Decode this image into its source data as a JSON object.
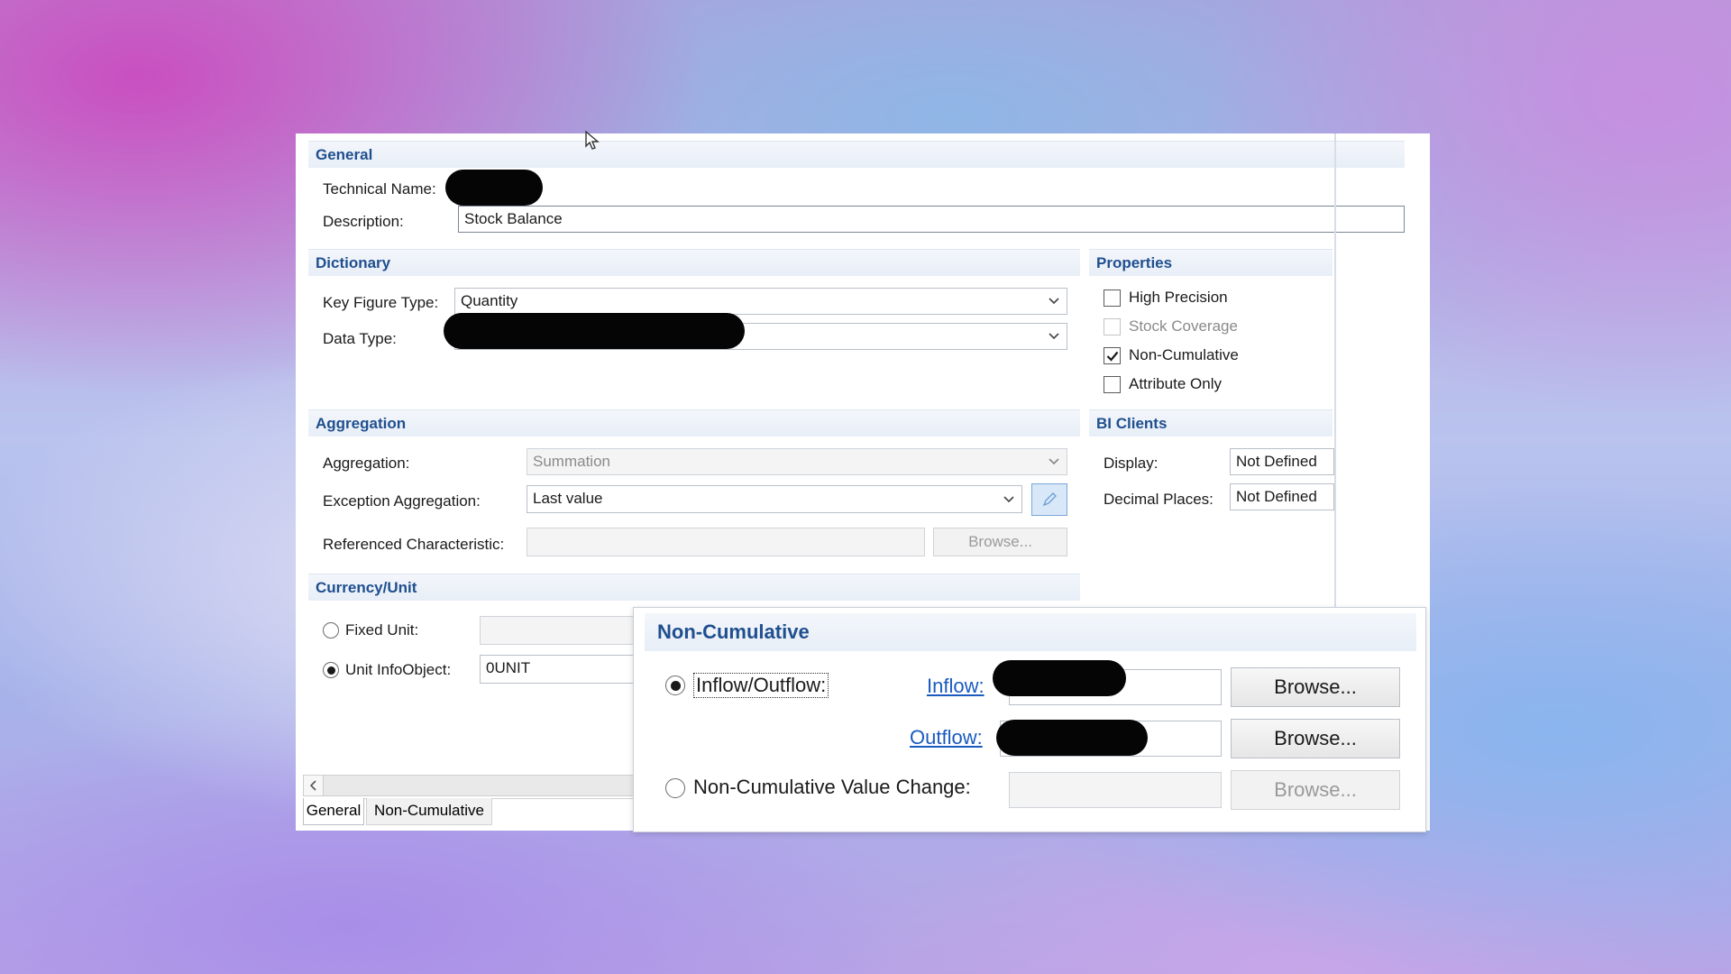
{
  "general": {
    "section_title": "General",
    "technical_name_label": "Technical Name:",
    "description_label": "Description:",
    "description_value": "Stock Balance"
  },
  "dictionary": {
    "section_title": "Dictionary",
    "key_figure_type_label": "Key Figure Type:",
    "key_figure_type_value": "Quantity",
    "data_type_label": "Data Type:"
  },
  "properties": {
    "section_title": "Properties",
    "items": [
      {
        "label": "High Precision",
        "checked": false,
        "enabled": true
      },
      {
        "label": "Stock Coverage",
        "checked": false,
        "enabled": false
      },
      {
        "label": "Non-Cumulative",
        "checked": true,
        "enabled": true
      },
      {
        "label": "Attribute Only",
        "checked": false,
        "enabled": true
      }
    ]
  },
  "aggregation": {
    "section_title": "Aggregation",
    "aggregation_label": "Aggregation:",
    "aggregation_value": "Summation",
    "exception_label": "Exception Aggregation:",
    "exception_value": "Last value",
    "referenced_label": "Referenced Characteristic:",
    "browse_label": "Browse..."
  },
  "bi_clients": {
    "section_title": "BI Clients",
    "display_label": "Display:",
    "display_value": "Not Defined",
    "decimal_label": "Decimal Places:",
    "decimal_value": "Not Defined"
  },
  "currency_unit": {
    "section_title": "Currency/Unit",
    "fixed_unit_label": "Fixed Unit:",
    "unit_infoobject_label": "Unit InfoObject:",
    "unit_infoobject_value": "0UNIT",
    "selected": "unit_infoobject"
  },
  "tabs": [
    "General",
    "Non-Cumulative"
  ],
  "non_cumulative": {
    "title": "Non-Cumulative",
    "inflow_outflow_label": "Inflow/Outflow:",
    "inflow_label": "Inflow:",
    "outflow_label": "Outflow:",
    "value_change_label": "Non-Cumulative Value Change:",
    "browse_label": "Browse...",
    "selected": "inflow_outflow"
  },
  "colors": {
    "section_title": "#1f4f8f",
    "link": "#1a5bbf",
    "redaction": "#050505"
  }
}
